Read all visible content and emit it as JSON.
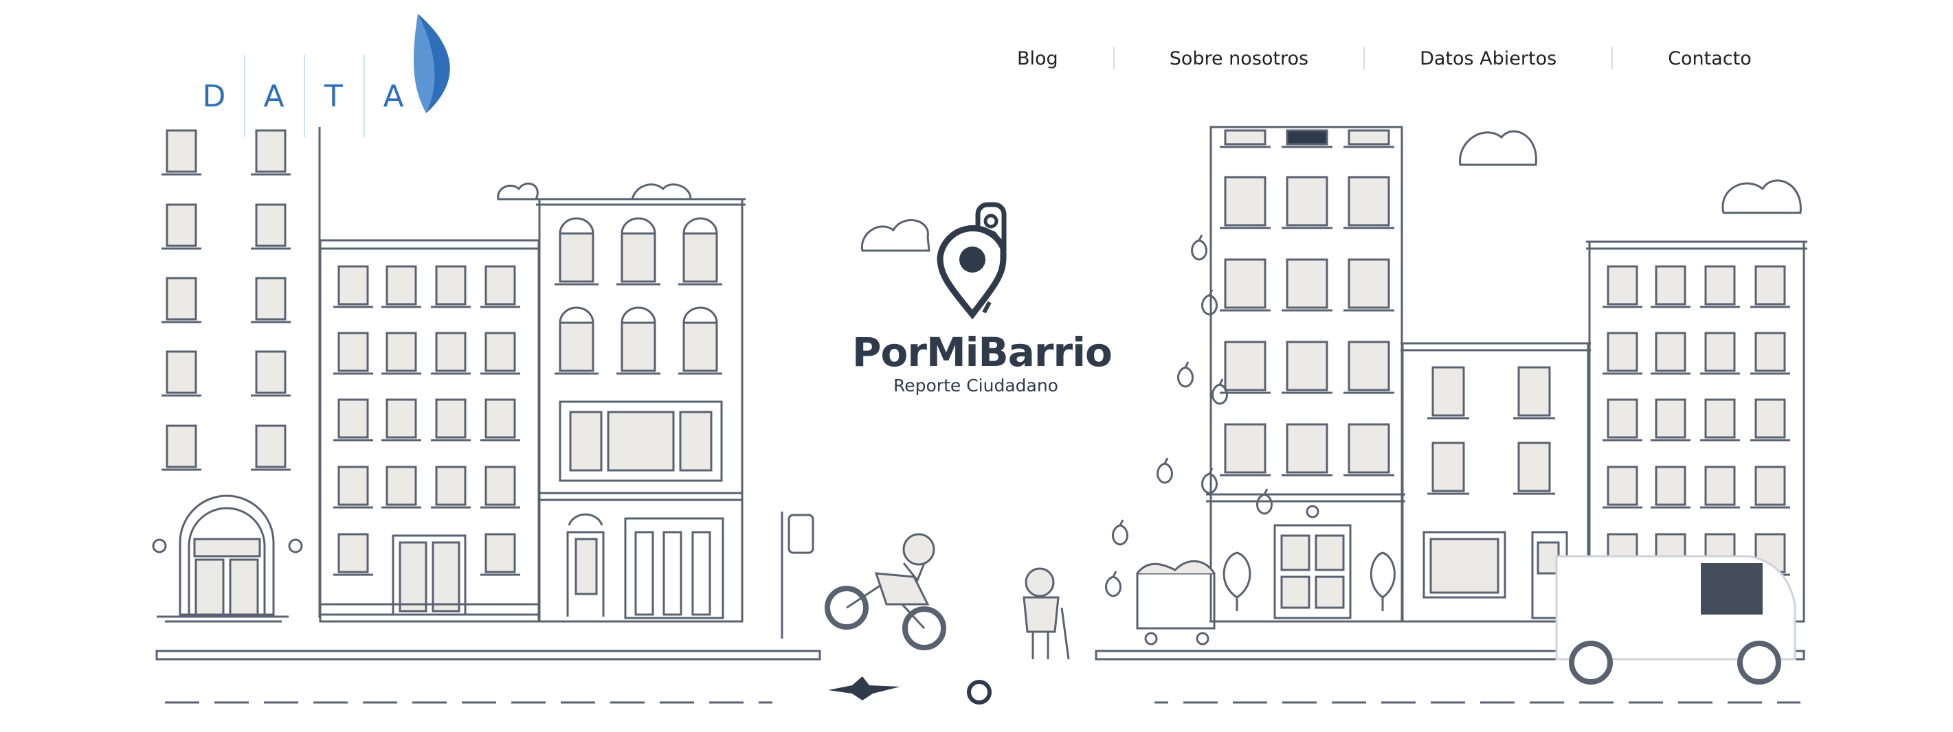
{
  "brand_logo": {
    "letters": [
      "D",
      "A",
      "T",
      "A"
    ],
    "color": "#2f6fb9"
  },
  "nav": {
    "items": [
      {
        "label": "Blog"
      },
      {
        "label": "Sobre nosotros"
      },
      {
        "label": "Datos Abiertos"
      },
      {
        "label": "Contacto"
      }
    ]
  },
  "hero": {
    "title": "PorMiBarrio",
    "subtitle": "Reporte Ciudadano",
    "ink_color": "#2f3a4a",
    "slides_indicator": "1"
  }
}
